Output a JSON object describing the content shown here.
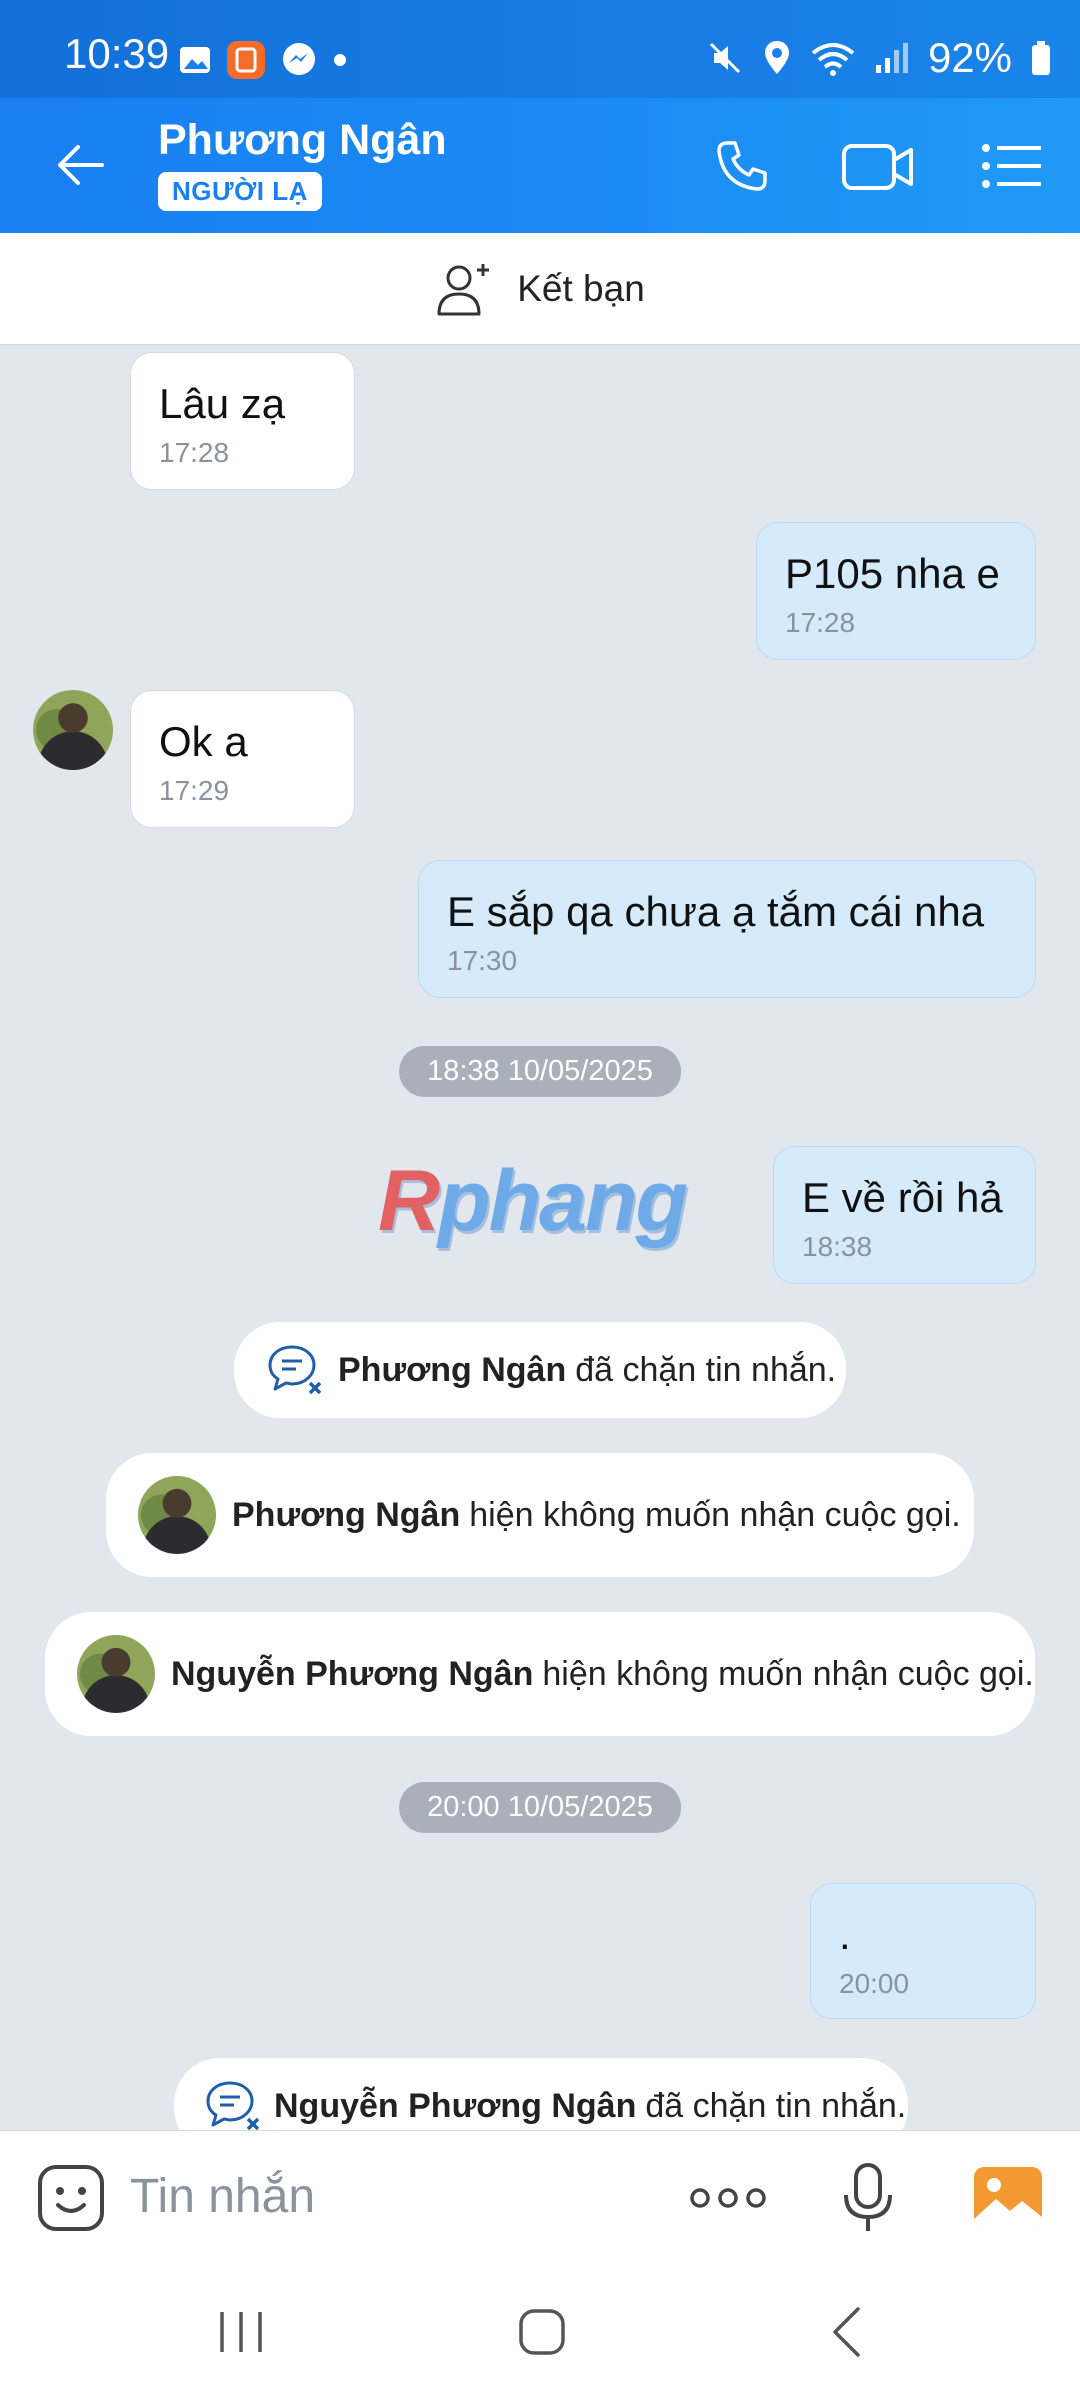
{
  "status_bar": {
    "time": "10:39",
    "battery": "92%"
  },
  "header": {
    "contact_name": "Phương Ngân",
    "tag": "NGƯỜI LẠ",
    "accent": "#1a7ff2"
  },
  "friend_bar": {
    "label": "Kết bạn"
  },
  "messages": [
    {
      "dir": "in",
      "text": "Lâu zạ",
      "time": "17:28"
    },
    {
      "dir": "out",
      "text": "P105 nha e",
      "time": "17:28"
    },
    {
      "dir": "in",
      "text": "Ok a",
      "time": "17:29"
    },
    {
      "dir": "out",
      "text": "E sắp qa chưa ạ tắm cái nha",
      "time": "17:30"
    },
    {
      "dir": "out",
      "text": "E về rồi hả",
      "time": "18:38"
    },
    {
      "dir": "out",
      "text": ".",
      "time": "20:00"
    }
  ],
  "date_separators": [
    "18:38 10/05/2025",
    "20:00 10/05/2025"
  ],
  "system_notices": [
    {
      "name": "Phương Ngân",
      "text": "đã chặn tin nhắn."
    },
    {
      "name": "Phương Ngân",
      "text": "hiện không muốn nhận cuộc gọi."
    },
    {
      "name": "Nguyễn Phương Ngân",
      "text": "hiện không muốn nhận cuộc gọi."
    },
    {
      "name": "Nguyễn Phương Ngân",
      "text": "đã chặn tin nhắn."
    }
  ],
  "watermark": {
    "first": "R",
    "rest": "phang"
  },
  "composer": {
    "placeholder": "Tin nhắn"
  }
}
